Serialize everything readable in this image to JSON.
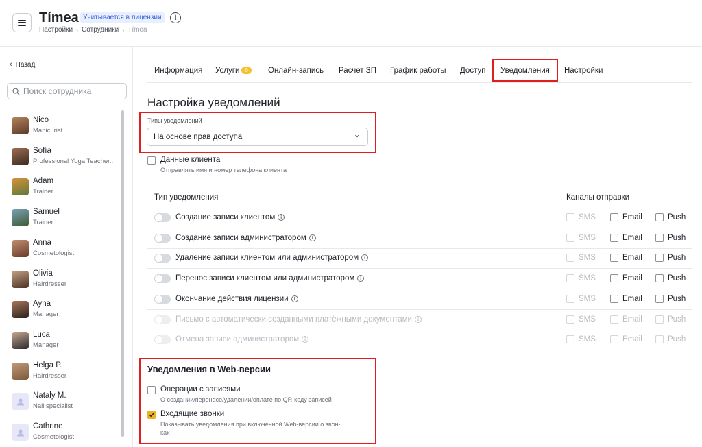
{
  "header": {
    "title": "Tímea",
    "license_badge": "Учитывается в лицензии",
    "breadcrumb": [
      "Настройки",
      "Сотрудники",
      "Tímea"
    ]
  },
  "sidebar": {
    "back_label": "Назад",
    "search_placeholder": "Поиск сотрудника",
    "staff": [
      {
        "name": "Nico",
        "role": "Manicurist",
        "avatar": "photo"
      },
      {
        "name": "Sofía",
        "role": "Professional Yoga Teacher...",
        "avatar": "photo"
      },
      {
        "name": "Adam",
        "role": "Trainer",
        "avatar": "photo"
      },
      {
        "name": "Samuel",
        "role": "Trainer",
        "avatar": "photo"
      },
      {
        "name": "Anna",
        "role": "Cosmetologist",
        "avatar": "photo"
      },
      {
        "name": "Olivia",
        "role": "Hairdresser",
        "avatar": "photo"
      },
      {
        "name": "Ayna",
        "role": "Manager",
        "avatar": "photo"
      },
      {
        "name": "Luca",
        "role": "Manager",
        "avatar": "photo"
      },
      {
        "name": "Helga P.",
        "role": "Hairdresser",
        "avatar": "photo"
      },
      {
        "name": "Nataly M.",
        "role": "Nail specialist",
        "avatar": "user-icon"
      },
      {
        "name": "Cathrine",
        "role": "Cosmetologist",
        "avatar": "user-icon"
      }
    ]
  },
  "tabs": [
    {
      "label": "Информация"
    },
    {
      "label": "Услуги",
      "count": "0"
    },
    {
      "label": "Онлайн-запись"
    },
    {
      "label": "Расчет ЗП"
    },
    {
      "label": "График работы"
    },
    {
      "label": "Доступ"
    },
    {
      "label": "Уведомления",
      "active": true
    },
    {
      "label": "Настройки"
    }
  ],
  "main": {
    "section_title": "Настройка уведомлений",
    "types_label": "Типы уведомлений",
    "types_value": "На основе прав доступа",
    "client_data": {
      "label": "Данные клиента",
      "desc": "Отправлять имя и номер телефона клиента",
      "checked": false
    },
    "col_type": "Тип уведомления",
    "col_channels": "Каналы отправки",
    "channels": [
      "SMS",
      "Email",
      "Push"
    ],
    "rows": [
      {
        "label": "Создание записи клиентом",
        "enabled": true
      },
      {
        "label": "Создание записи администратором",
        "enabled": true
      },
      {
        "label": "Удаление записи клиентом или администратором",
        "enabled": true
      },
      {
        "label": "Перенос записи клиентом или администратором",
        "enabled": true
      },
      {
        "label": "Окончание действия лицензии",
        "enabled": true
      },
      {
        "label": "Письмо с автоматически созданными платёжными документами",
        "enabled": false
      },
      {
        "label": "Отмена записи администратором",
        "enabled": false
      }
    ],
    "web_title": "Уведомления в Web-версии",
    "web_items": [
      {
        "label": "Операции с записями",
        "desc": "О создании/переносе/удалении/оплате по QR-коду записей",
        "checked": false
      },
      {
        "label": "Входящие звонки",
        "desc_line1": "Показывать уведомления при включенной Web-версии о звон-",
        "desc_line2": "ках",
        "checked": true
      }
    ]
  },
  "colors": {
    "accent": "#f0b21a",
    "highlight": "#e01e1e",
    "badge": "#3a66d8"
  }
}
